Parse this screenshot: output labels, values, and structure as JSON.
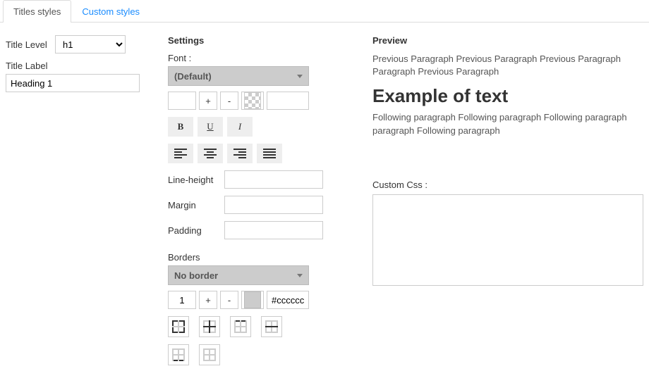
{
  "tabs": {
    "titles": "Titles styles",
    "custom": "Custom styles"
  },
  "left": {
    "title_level_label": "Title Level",
    "title_level_value": "h1",
    "title_label_label": "Title Label",
    "title_label_value": "Heading 1"
  },
  "settings": {
    "heading": "Settings",
    "font_label": "Font :",
    "font_value": "(Default)",
    "font_size_value": "",
    "plus": "+",
    "minus": "-",
    "bold": "B",
    "underline": "U",
    "italic": "I",
    "line_height_label": "Line-height",
    "margin_label": "Margin",
    "padding_label": "Padding",
    "borders_label": "Borders",
    "borders_value": "No border",
    "border_width_value": "1",
    "border_color_value": "#cccccc"
  },
  "preview": {
    "heading": "Preview",
    "prev_para": "Previous Paragraph Previous Paragraph Previous Paragraph Paragraph Previous Paragraph",
    "example": "Example of text",
    "next_para": "Following paragraph Following paragraph Following paragraph paragraph Following paragraph",
    "custom_css_label": "Custom Css :"
  }
}
